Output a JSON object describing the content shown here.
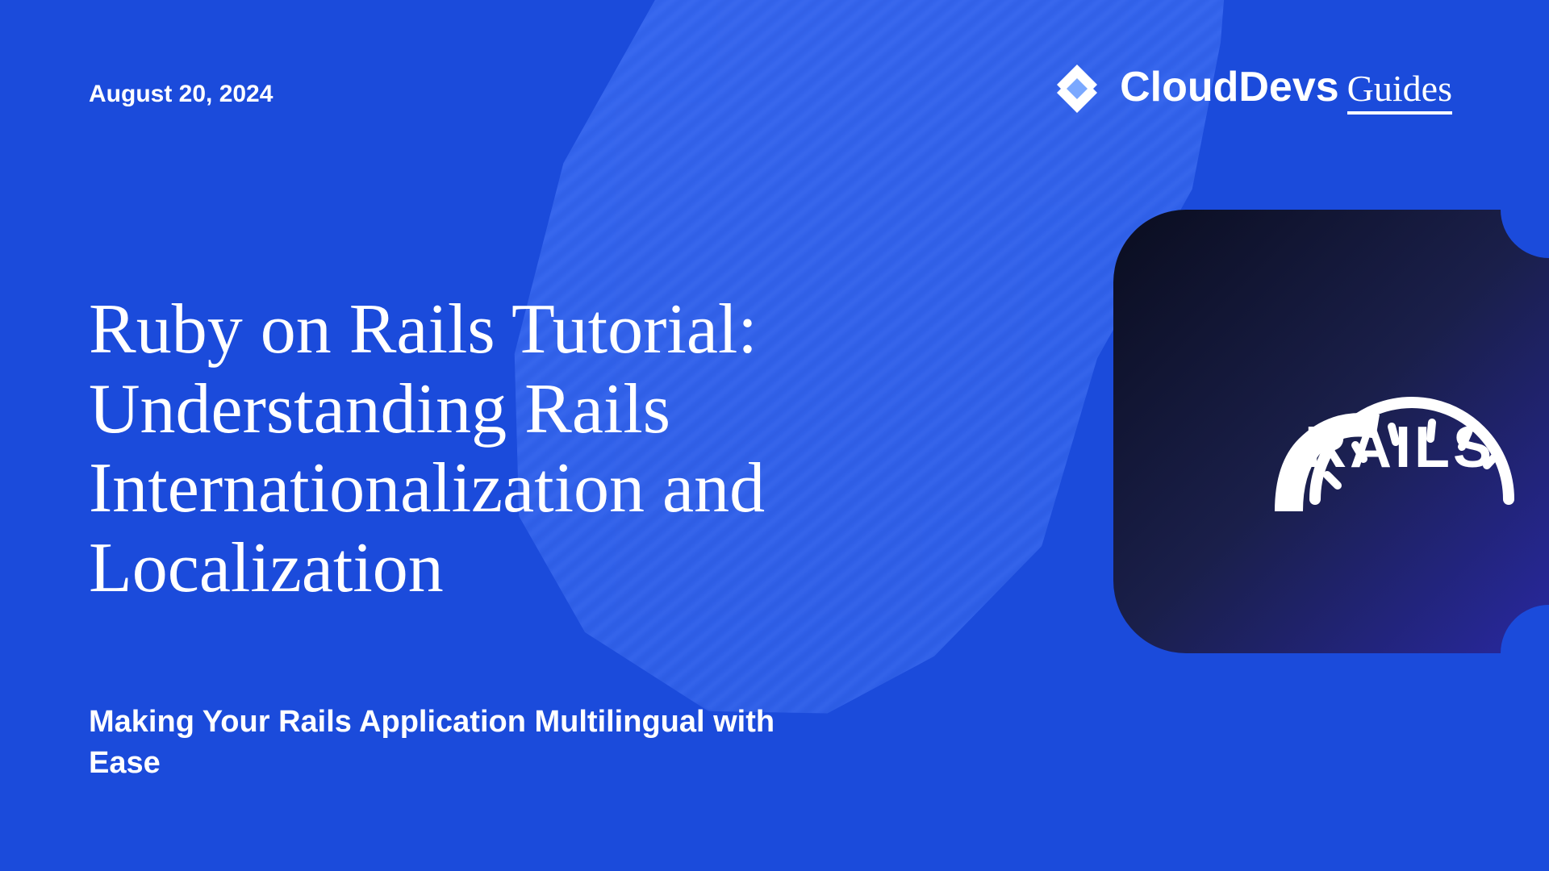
{
  "date": "August 20, 2024",
  "brand": {
    "main": "CloudDevs",
    "sub": "Guides"
  },
  "title": "Ruby on Rails Tutorial: Understanding Rails Internationalization and Localization",
  "subtitle": "Making Your Rails Application Multilingual with Ease",
  "rails_logo_text": "RAILS"
}
